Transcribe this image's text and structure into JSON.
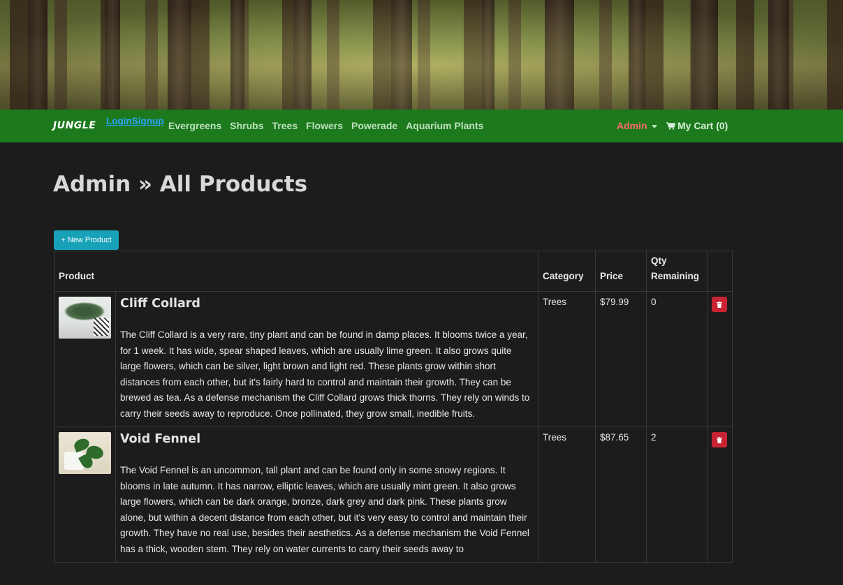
{
  "nav": {
    "brand": "JUNGLE",
    "login": "Login",
    "signup": "Signup",
    "categories": [
      "Evergreens",
      "Shrubs",
      "Trees",
      "Flowers",
      "Powerade",
      "Aquarium Plants"
    ],
    "admin_label": "Admin",
    "cart_label": "My Cart (0)"
  },
  "page": {
    "title": "Admin » All Products",
    "new_button": "+ New Product"
  },
  "table": {
    "headers": [
      "Product",
      "Category",
      "Price",
      "Qty Remaining"
    ],
    "rows": [
      {
        "name": "Cliff Collard",
        "description": "The Cliff Collard is a very rare, tiny plant and can be found in damp places. It blooms twice a year, for 1 week. It has wide, spear shaped leaves, which are usually lime green. It also grows quite large flowers, which can be silver, light brown and light red. These plants grow within short distances from each other, but it's fairly hard to control and maintain their growth. They can be brewed as tea. As a defense mechanism the Cliff Collard grows thick thorns. They rely on winds to carry their seeds away to reproduce. Once pollinated, they grow small, inedible fruits.",
        "category": "Trees",
        "price": "$79.99",
        "qty": "0"
      },
      {
        "name": "Void Fennel",
        "description": "The Void Fennel is an uncommon, tall plant and can be found only in some snowy regions. It blooms in late autumn. It has narrow, elliptic leaves, which are usually mint green. It also grows large flowers, which can be dark orange, bronze, dark grey and dark pink. These plants grow alone, but within a decent distance from each other, but it's very easy to control and maintain their growth. They have no real use, besides their aesthetics. As a defense mechanism the Void Fennel has a thick, wooden stem. They rely on water currents to carry their seeds away to",
        "category": "Trees",
        "price": "$87.65",
        "qty": "2"
      }
    ]
  },
  "colors": {
    "navbar": "#1c7a1c",
    "background": "#1c1c1c",
    "admin_link": "#ff6b6b",
    "auth_link": "#2aa3ff",
    "new_button": "#17a2b8",
    "delete_button": "#c82333"
  },
  "icons": [
    "cart-icon",
    "trash-icon"
  ]
}
